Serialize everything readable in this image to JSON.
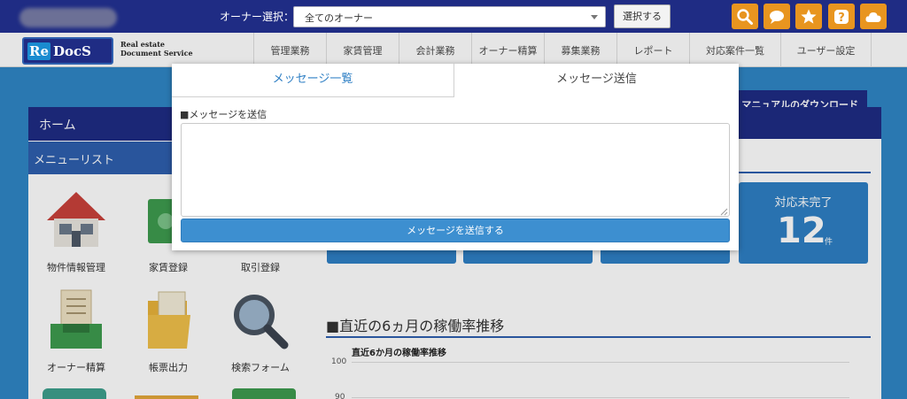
{
  "topbar": {
    "owner_label": "オーナー選択：",
    "owner_select_value": "全てのオーナー",
    "select_button": "選択する",
    "icons": [
      "search-icon",
      "chat-icon",
      "star-icon",
      "help-icon",
      "cloud-icon"
    ],
    "accent_color": "#e8951f",
    "bar_color": "#1f2c84"
  },
  "logo": {
    "re": "Re",
    "docs": "DocS",
    "sub_line1": "Real estate",
    "sub_line2": "Document Service"
  },
  "nav": {
    "items": [
      "管理業務",
      "家賃管理",
      "会計業務",
      "オーナー精算",
      "募集業務",
      "レポート",
      "対応案件一覧",
      "ユーザー設定"
    ]
  },
  "page": {
    "home_title": "ホーム",
    "menu_list_title": "メニューリスト",
    "manual_download": "マニュアルのダウンロード",
    "menu_items": [
      "物件情報管理",
      "家賃登録",
      "取引登録",
      "オーナー精算",
      "帳票出力",
      "検索フォーム"
    ],
    "stat_title": "対応未完了",
    "stat_value": "12",
    "stat_unit": "件",
    "section_title": "■直近の6ヵ月の稼働率推移",
    "chart_title": "直近6か月の稼働率推移",
    "tick_100": "100",
    "tick_90": "90"
  },
  "modal": {
    "tab_list": "メッセージ一覧",
    "tab_send": "メッセージ送信",
    "field_label": "■メッセージを送信",
    "textarea_value": "",
    "send_button": "メッセージを送信する"
  }
}
